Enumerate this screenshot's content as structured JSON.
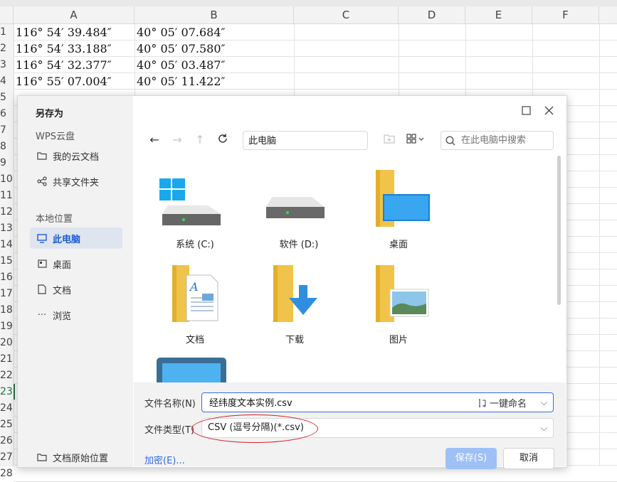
{
  "sheet": {
    "columns": [
      "A",
      "B",
      "C",
      "D",
      "E",
      "F"
    ],
    "row_numbers": [
      "1",
      "2",
      "3",
      "4",
      "5",
      "6",
      "7",
      "8",
      "9",
      "10",
      "11",
      "12",
      "13",
      "14",
      "15",
      "16",
      "17",
      "18",
      "19",
      "20",
      "21",
      "22",
      "23",
      "24",
      "25",
      "26",
      "27",
      "28"
    ],
    "active_row": "23",
    "rows": [
      {
        "a": "116° 54′ 39.484″",
        "b": "40° 05′ 07.684″"
      },
      {
        "a": "116° 54′ 33.188″",
        "b": "40° 05′ 07.580″"
      },
      {
        "a": "116° 54′ 32.377″",
        "b": "40° 05′ 03.487″"
      },
      {
        "a": "116° 55′ 07.004″",
        "b": "40° 05′ 11.422″"
      }
    ]
  },
  "dialog": {
    "title": "另存为",
    "sidebar": {
      "cloud_section": "WPS云盘",
      "cloud_items": [
        {
          "label": "我的云文档",
          "icon": "folder-icon"
        },
        {
          "label": "共享文件夹",
          "icon": "share-icon"
        }
      ],
      "local_section": "本地位置",
      "local_items": [
        {
          "label": "此电脑",
          "icon": "computer-icon",
          "selected": true
        },
        {
          "label": "桌面",
          "icon": "desktop-icon"
        },
        {
          "label": "文档",
          "icon": "document-icon"
        },
        {
          "label": "浏览",
          "icon": "more-icon"
        }
      ],
      "bottom_item": {
        "label": "文档原始位置",
        "icon": "folder-icon"
      }
    },
    "path": "此电脑",
    "search_placeholder": "在此电脑中搜索",
    "items": [
      {
        "label": "系统 (C:)",
        "icon": "system-drive-icon"
      },
      {
        "label": "软件 (D:)",
        "icon": "drive-icon"
      },
      {
        "label": "桌面",
        "icon": "desktop-folder-icon"
      },
      {
        "label": "文档",
        "icon": "documents-folder-icon"
      },
      {
        "label": "下载",
        "icon": "downloads-folder-icon"
      },
      {
        "label": "图片",
        "icon": "pictures-folder-icon"
      }
    ],
    "filename_label": "文件名称(N)",
    "filename_value": "经纬度文本实例.csv",
    "rename_label": "一键命名",
    "filetype_label": "文件类型(T)",
    "filetype_value": "CSV (逗号分隔)(*.csv)",
    "encrypt_label": "加密(E)...",
    "save_label": "保存(S)",
    "cancel_label": "取消",
    "colors": {
      "accent": "#2f6ce5",
      "selected_bg": "#dfe5ef",
      "annotation": "#d62020"
    }
  }
}
